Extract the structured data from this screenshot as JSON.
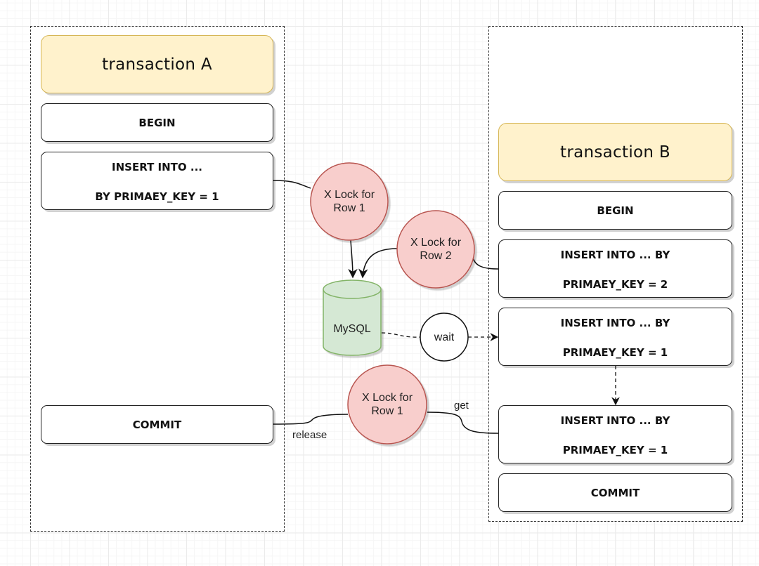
{
  "colors": {
    "title_fill": "#fff2cc",
    "title_stroke": "#d6b656",
    "lock_fill": "#f8cecc",
    "lock_stroke": "#b85450",
    "db_fill": "#d5e8d4",
    "db_stroke": "#82b366"
  },
  "transaction_a": {
    "title": "transaction A",
    "begin": "BEGIN",
    "insert": {
      "line1": "INSERT INTO ...",
      "line2": "BY PRIMAEY_KEY = 1"
    },
    "commit": "COMMIT"
  },
  "transaction_b": {
    "title": "transaction B",
    "begin": "BEGIN",
    "insert_key2": {
      "line1": "INSERT INTO ... BY",
      "line2": "PRIMAEY_KEY = 2"
    },
    "insert_key1_waiting": {
      "line1": "INSERT INTO ... BY",
      "line2": "PRIMAEY_KEY = 1"
    },
    "insert_key1_granted": {
      "line1": "INSERT INTO ... BY",
      "line2": "PRIMAEY_KEY = 1"
    },
    "commit": "COMMIT"
  },
  "nodes": {
    "lock_row1_top": "X Lock for\nRow 1",
    "lock_row2": "X Lock for\nRow 2",
    "database": "MySQL",
    "wait": "wait",
    "lock_row1_bottom": "X Lock for\nRow 1"
  },
  "edge_labels": {
    "release": "release",
    "get": "get"
  }
}
